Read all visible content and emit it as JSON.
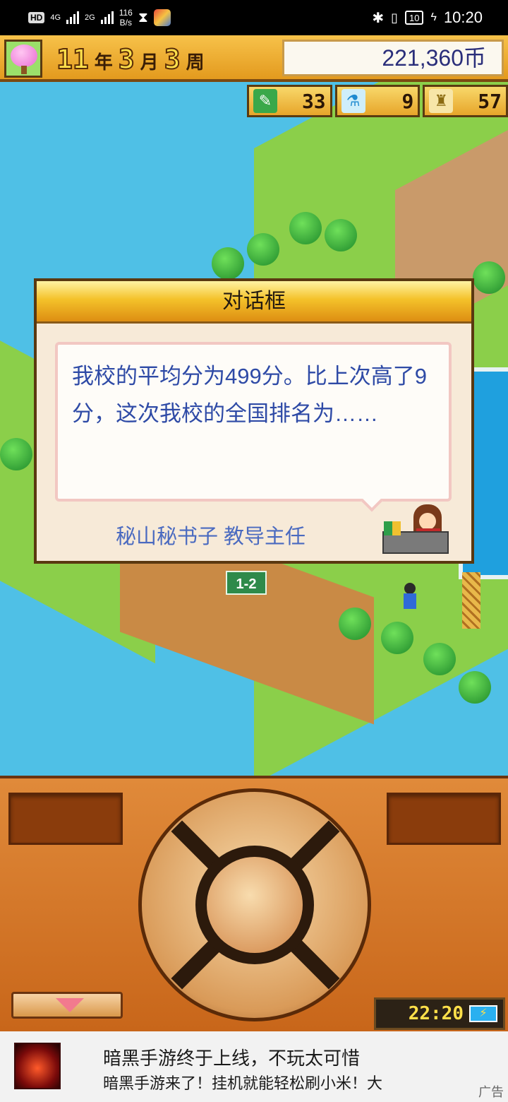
{
  "status_bar": {
    "hd": "HD",
    "net1": "4G",
    "net2": "2G",
    "speed_value": "116",
    "speed_unit": "B/s",
    "battery": "10",
    "time": "10:20"
  },
  "topbar": {
    "year": "11",
    "year_unit": "年",
    "month": "3",
    "month_unit": "月",
    "week": "3",
    "week_unit": "周",
    "money": "221,360币"
  },
  "resources": [
    {
      "icon": "pencil-icon",
      "value": "33"
    },
    {
      "icon": "flask-icon",
      "value": "9"
    },
    {
      "icon": "trophy-icon",
      "value": "57"
    }
  ],
  "map": {
    "classroom_sign": "1-2"
  },
  "dialog": {
    "title": "对话框",
    "message": "我校的平均分为499分。比上次高了9分，这次我校的全国排名为……",
    "speaker": "秘山秘书子 教导主任"
  },
  "controller": {
    "clock": "22:20",
    "battery_glyph": "⚡"
  },
  "ad": {
    "title": "暗黑手游终于上线，不玩太可惜",
    "subtitle": "暗黑手游来了！挂机就能轻松刷小米！大",
    "tag": "广告"
  },
  "colors": {
    "sky_water": "#4fc0e6",
    "dialog_text": "#2e4aa6",
    "title_gold": "#f4c22a",
    "controller_orange": "#e08a3a"
  }
}
